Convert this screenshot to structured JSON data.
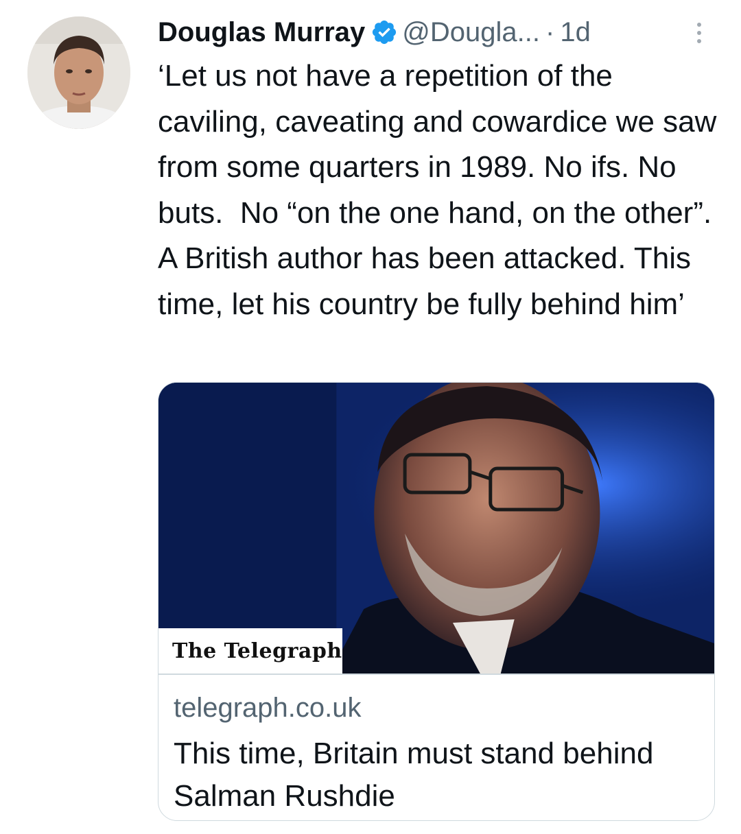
{
  "tweet": {
    "author_name": "Douglas Murray",
    "handle": "@Dougla...",
    "separator": "·",
    "timestamp": "1d",
    "verified": true,
    "text": "‘Let us not have a repetition of the caviling, caveating and cowardice we saw from some quarters in 1989. No ifs. No buts.  No “on the one hand, on the other”. A British author has been attacked. This time, let his country be fully behind him’",
    "icons": {
      "verified": "verified-badge-icon",
      "more": "more-options-icon"
    },
    "colors": {
      "text": "#0f1419",
      "secondary": "#536471",
      "verified": "#1d9bf0",
      "border": "#cfd9de"
    }
  },
  "link_card": {
    "source_label": "The Telegraph",
    "domain": "telegraph.co.uk",
    "title": "This time, Britain must stand behind Salman Rushdie"
  }
}
